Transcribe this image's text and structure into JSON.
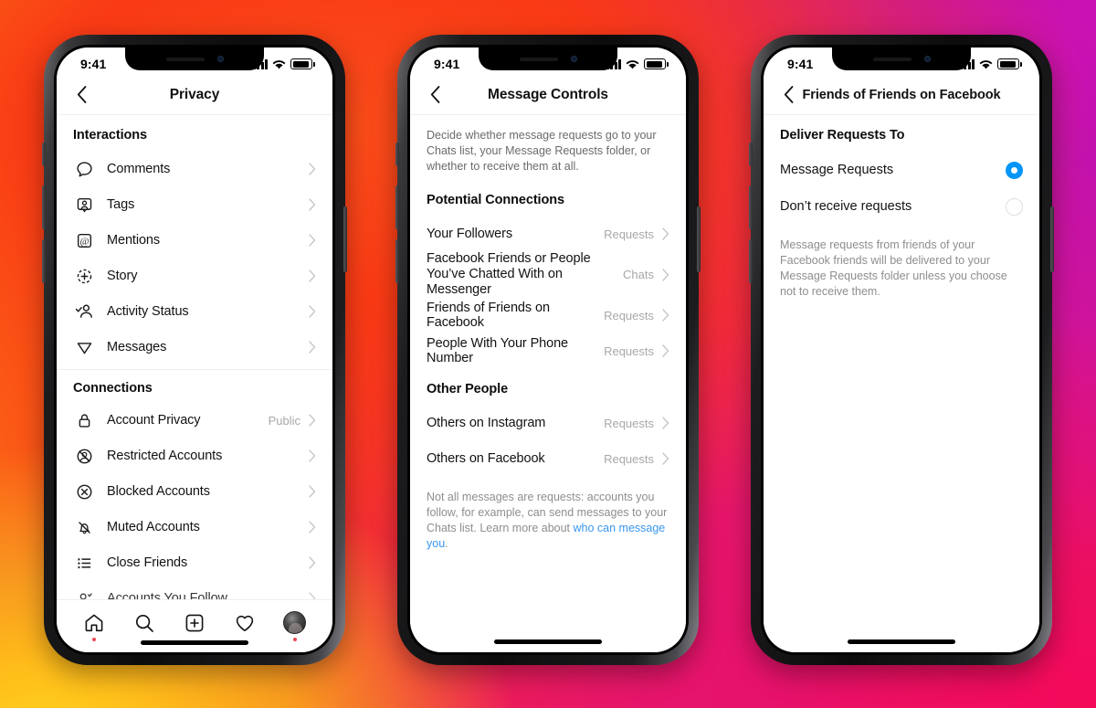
{
  "background": {
    "colors": [
      "#fd9a14",
      "#fb3d18",
      "#ea1a5f",
      "#c912ae",
      "#ffd21e"
    ]
  },
  "accent": {
    "blue": "#0095f6",
    "link": "#3897f0",
    "notification": "#ed4956"
  },
  "phones": [
    {
      "status_bar": {
        "time": "9:41",
        "signal_icon": "cellular-bars-icon",
        "wifi_icon": "wifi-icon",
        "battery_icon": "battery-full-icon"
      },
      "nav": {
        "back_icon": "chevron-left-icon",
        "title": "Privacy"
      },
      "sections": [
        {
          "heading": "Interactions",
          "rows": [
            {
              "icon": "comment-bubble-icon",
              "label": "Comments",
              "value": "",
              "chevron": "chevron-right-icon"
            },
            {
              "icon": "tag-person-icon",
              "label": "Tags",
              "value": "",
              "chevron": "chevron-right-icon"
            },
            {
              "icon": "at-mention-icon",
              "label": "Mentions",
              "value": "",
              "chevron": "chevron-right-icon"
            },
            {
              "icon": "story-plus-icon",
              "label": "Story",
              "value": "",
              "chevron": "chevron-right-icon"
            },
            {
              "icon": "activity-status-icon",
              "label": "Activity Status",
              "value": "",
              "chevron": "chevron-right-icon"
            },
            {
              "icon": "paper-plane-icon",
              "label": "Messages",
              "value": "",
              "chevron": "chevron-right-icon"
            }
          ]
        },
        {
          "heading": "Connections",
          "rows": [
            {
              "icon": "lock-icon",
              "label": "Account Privacy",
              "value": "Public",
              "chevron": "chevron-right-icon"
            },
            {
              "icon": "restricted-account-icon",
              "label": "Restricted Accounts",
              "value": "",
              "chevron": "chevron-right-icon"
            },
            {
              "icon": "blocked-circle-x-icon",
              "label": "Blocked Accounts",
              "value": "",
              "chevron": "chevron-right-icon"
            },
            {
              "icon": "muted-bell-icon",
              "label": "Muted Accounts",
              "value": "",
              "chevron": "chevron-right-icon"
            },
            {
              "icon": "close-friends-list-icon",
              "label": "Close Friends",
              "value": "",
              "chevron": "chevron-right-icon"
            },
            {
              "icon": "accounts-you-follow-icon",
              "label": "Accounts You Follow",
              "value": "",
              "chevron": "chevron-right-icon"
            }
          ]
        }
      ],
      "tabbar": {
        "tabs": [
          {
            "icon": "home-icon",
            "name": "home",
            "badge": true
          },
          {
            "icon": "search-icon",
            "name": "search",
            "badge": false
          },
          {
            "icon": "add-post-icon",
            "name": "create",
            "badge": false
          },
          {
            "icon": "heart-icon",
            "name": "activity",
            "badge": false
          },
          {
            "icon": "profile-avatar-icon",
            "name": "profile",
            "badge": true
          }
        ]
      }
    },
    {
      "status_bar": {
        "time": "9:41",
        "signal_icon": "cellular-bars-icon",
        "wifi_icon": "wifi-icon",
        "battery_icon": "battery-full-icon"
      },
      "nav": {
        "back_icon": "chevron-left-icon",
        "title": "Message Controls"
      },
      "intro": "Decide whether message requests go to your Chats list, your Message Requests folder, or whether to receive them at all.",
      "sections": [
        {
          "heading": "Potential Connections",
          "rows": [
            {
              "label": "Your Followers",
              "value": "Requests",
              "chevron": "chevron-right-icon",
              "twoline": false
            },
            {
              "label": "Facebook Friends or People You’ve Chatted With on Messenger",
              "value": "Chats",
              "chevron": "chevron-right-icon",
              "twoline": true
            },
            {
              "label": "Friends of Friends on Facebook",
              "value": "Requests",
              "chevron": "chevron-right-icon",
              "twoline": false
            },
            {
              "label": "People With Your Phone Number",
              "value": "Requests",
              "chevron": "chevron-right-icon",
              "twoline": false
            }
          ]
        },
        {
          "heading": "Other People",
          "rows": [
            {
              "label": "Others on Instagram",
              "value": "Requests",
              "chevron": "chevron-right-icon",
              "twoline": false
            },
            {
              "label": "Others on Facebook",
              "value": "Requests",
              "chevron": "chevron-right-icon",
              "twoline": false
            }
          ]
        }
      ],
      "footnote": {
        "text_before": "Not all messages are requests: accounts you follow, for example, can send messages to your Chats list. Learn more about ",
        "link": "who can message you",
        "text_after": "."
      }
    },
    {
      "status_bar": {
        "time": "9:41",
        "signal_icon": "cellular-bars-icon",
        "wifi_icon": "wifi-icon",
        "battery_icon": "battery-full-icon"
      },
      "nav": {
        "back_icon": "chevron-left-icon",
        "title": "Friends of Friends on Facebook"
      },
      "section_heading": "Deliver Requests To",
      "options": [
        {
          "label": "Message Requests",
          "selected": true
        },
        {
          "label": "Don’t receive requests",
          "selected": false
        }
      ],
      "footnote": "Message requests from friends of your Facebook friends will be delivered to your Message Requests folder unless you choose not to receive them."
    }
  ]
}
